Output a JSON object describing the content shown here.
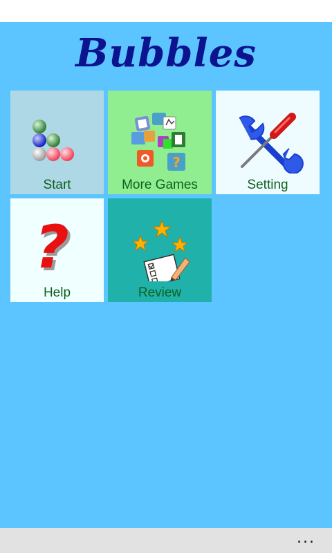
{
  "app": {
    "title": "Bubbles",
    "background": "#5cc4fe"
  },
  "tiles": [
    {
      "label": "Start",
      "icon": "bubbles-icon",
      "color": "#aed8e6"
    },
    {
      "label": "More Games",
      "icon": "games-collage-icon",
      "color": "#90ee90"
    },
    {
      "label": "Setting",
      "icon": "wrench-screwdriver-icon",
      "color": "#eefcff"
    },
    {
      "label": "Help",
      "icon": "question-mark-icon",
      "color": "#f0ffff"
    },
    {
      "label": "Review",
      "icon": "stars-checklist-icon",
      "color": "#20b2aa"
    }
  ],
  "app_bar": {
    "more_label": "..."
  }
}
